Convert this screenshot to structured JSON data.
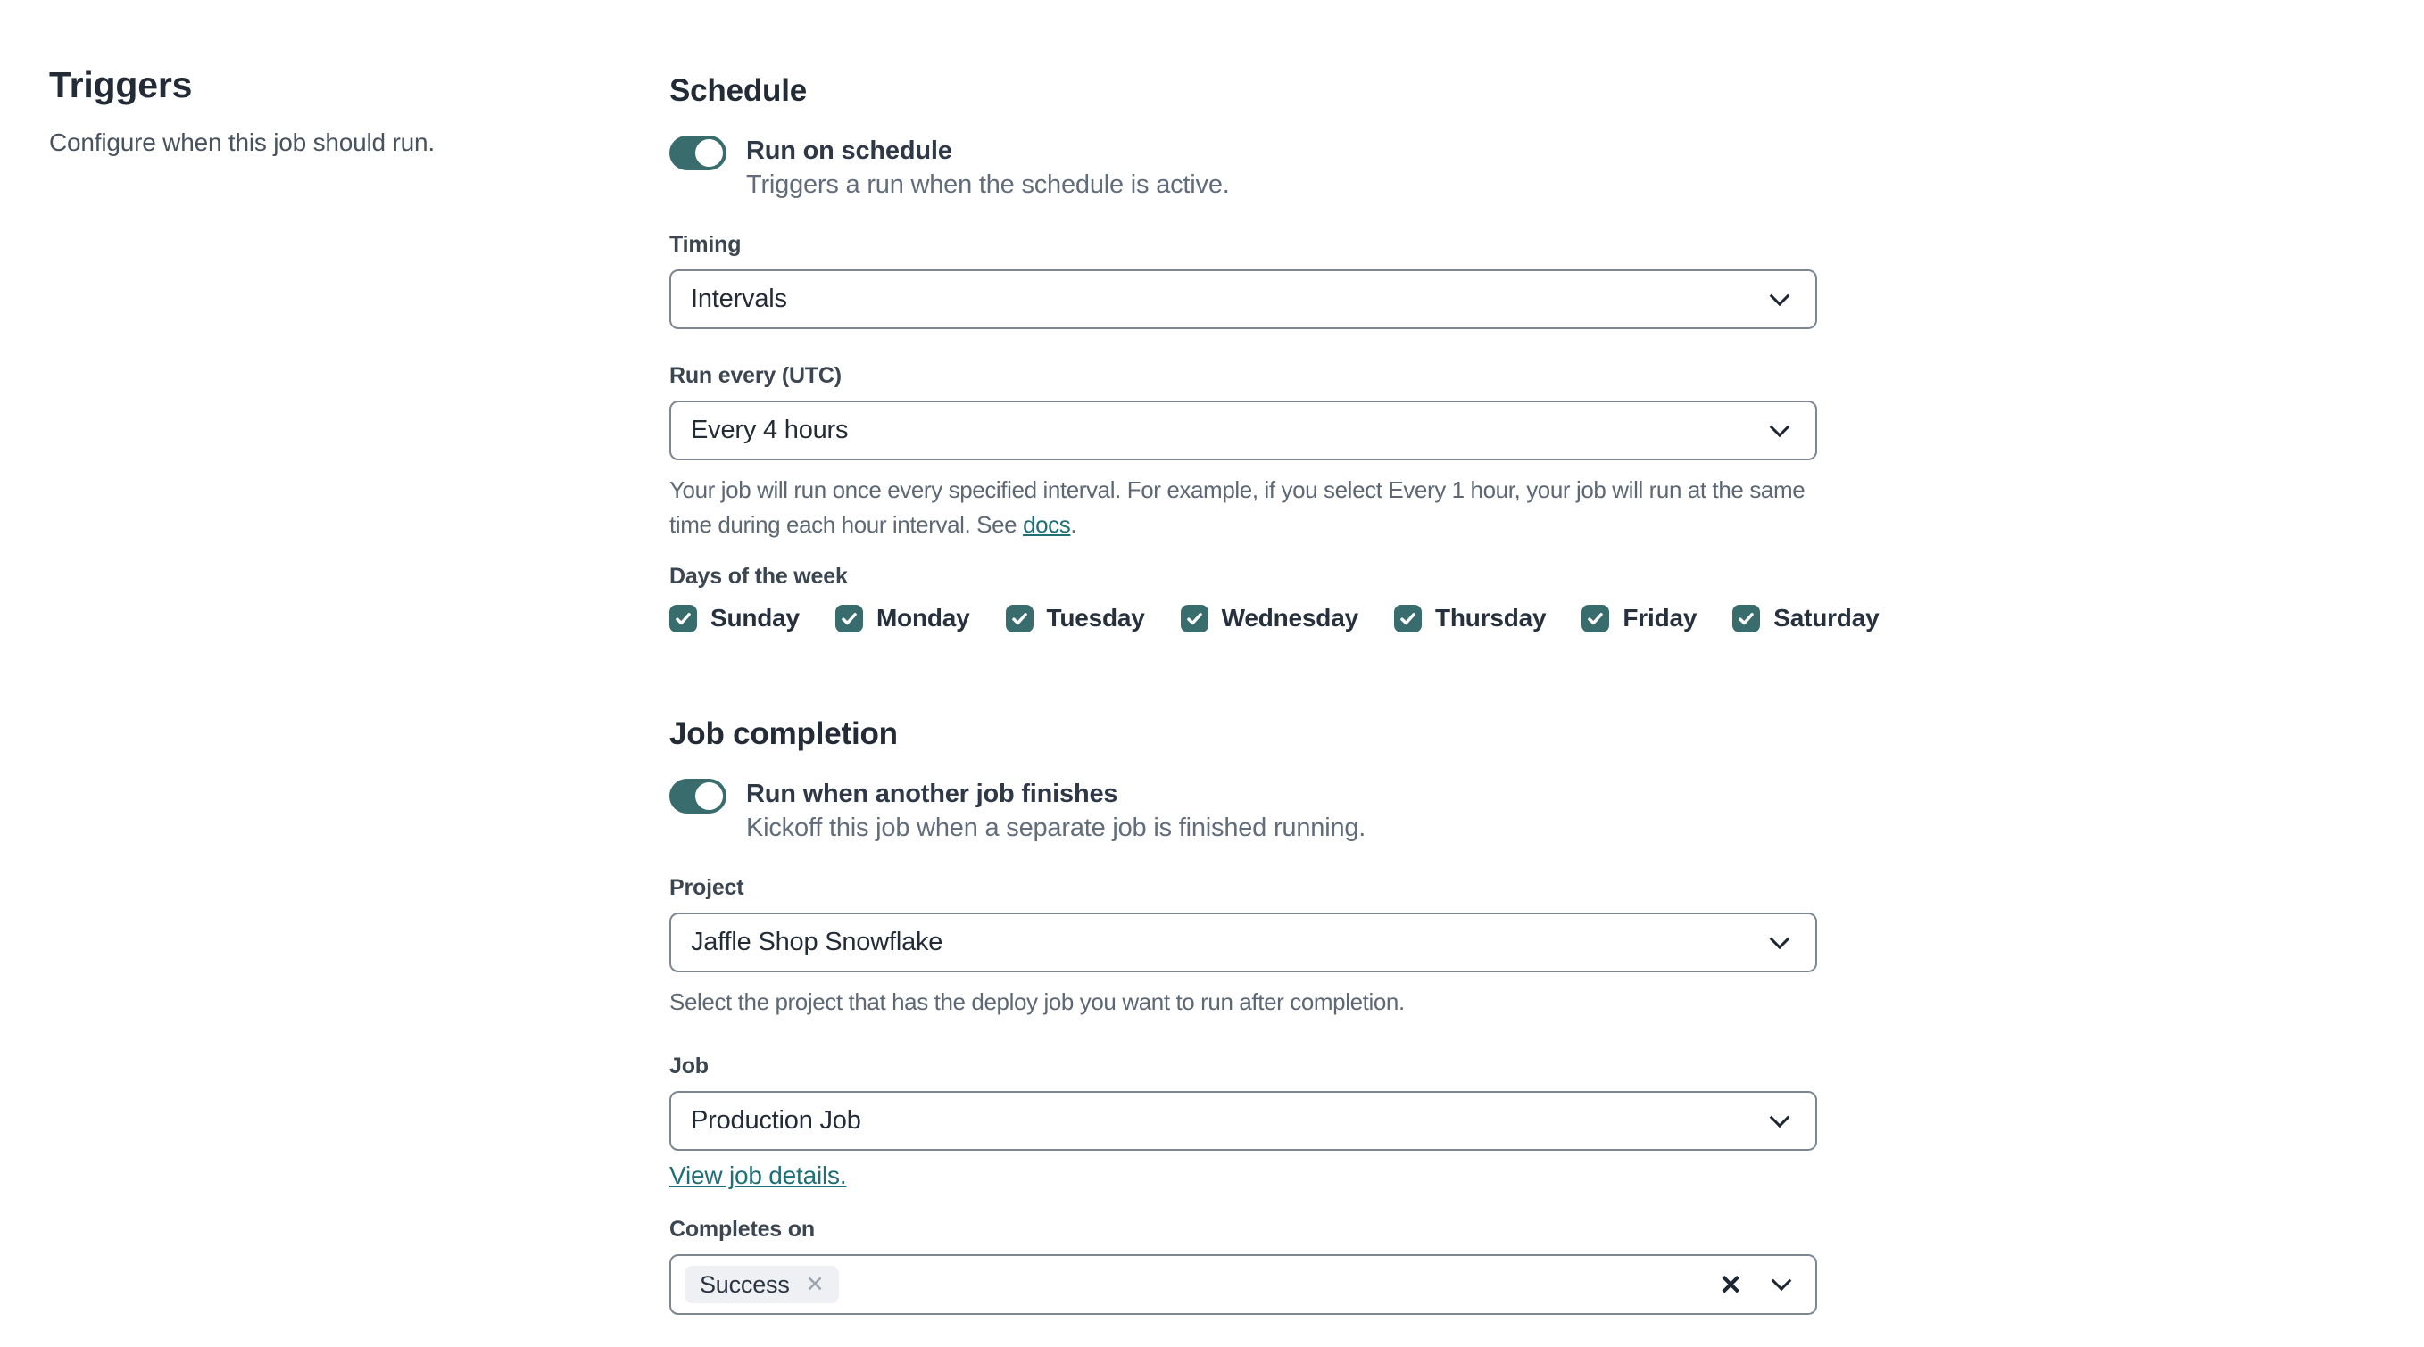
{
  "sidebar": {
    "title": "Triggers",
    "description": "Configure when this job should run."
  },
  "schedule": {
    "heading": "Schedule",
    "toggle": {
      "label": "Run on schedule",
      "description": "Triggers a run when the schedule is active.",
      "state": "on"
    },
    "timing": {
      "label": "Timing",
      "value": "Intervals"
    },
    "run_every": {
      "label": "Run every (UTC)",
      "value": "Every 4 hours",
      "help_before_link": "Your job will run once every specified interval. For example, if you select Every 1 hour, your job will run at the same time during each hour interval. See ",
      "help_link": "docs",
      "help_after_link": "."
    },
    "days": {
      "label": "Days of the week",
      "items": [
        {
          "label": "Sunday",
          "checked": true
        },
        {
          "label": "Monday",
          "checked": true
        },
        {
          "label": "Tuesday",
          "checked": true
        },
        {
          "label": "Wednesday",
          "checked": true
        },
        {
          "label": "Thursday",
          "checked": true
        },
        {
          "label": "Friday",
          "checked": true
        },
        {
          "label": "Saturday",
          "checked": true
        }
      ]
    }
  },
  "job_completion": {
    "heading": "Job completion",
    "toggle": {
      "label": "Run when another job finishes",
      "description": "Kickoff this job when a separate job is finished running.",
      "state": "on"
    },
    "project": {
      "label": "Project",
      "value": "Jaffle Shop Snowflake",
      "help": "Select the project that has the deploy job you want to run after completion."
    },
    "job": {
      "label": "Job",
      "value": "Production Job",
      "link": "View job details."
    },
    "completes_on": {
      "label": "Completes on",
      "selected": [
        "Success"
      ]
    }
  },
  "colors": {
    "accent_teal": "#386c6d",
    "link_teal": "#1f7076",
    "border_gray": "#7e8791",
    "pill_bg": "#eef0f3"
  }
}
